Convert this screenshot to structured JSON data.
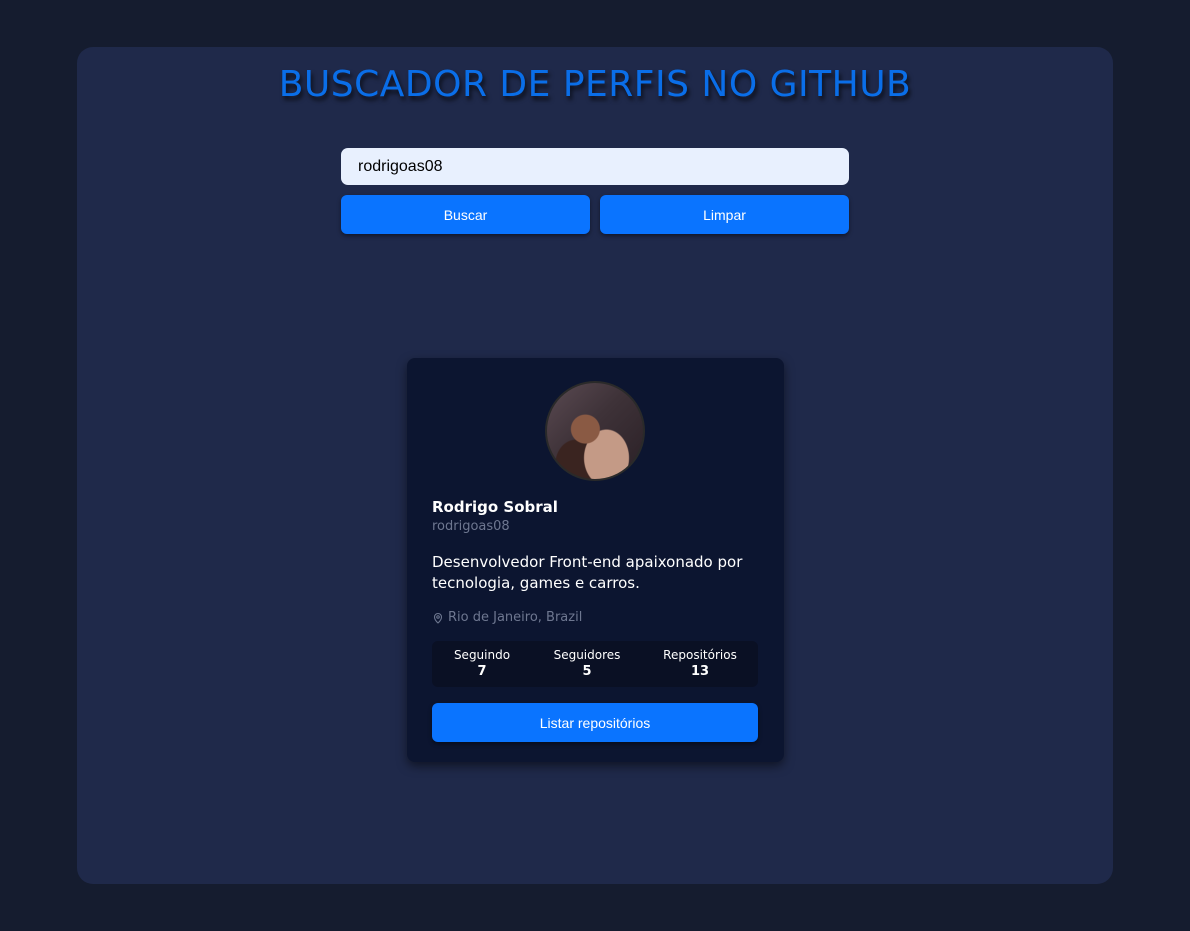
{
  "page": {
    "title": "BUSCADOR DE PERFIS NO GITHUB"
  },
  "search": {
    "value": "rodrigoas08",
    "search_button": "Buscar",
    "clear_button": "Limpar"
  },
  "profile": {
    "name": "Rodrigo Sobral",
    "login": "rodrigoas08",
    "bio": "Desenvolvedor Front-end apaixonado por tecnologia, games e carros.",
    "location": "Rio de Janeiro, Brazil",
    "stats": [
      {
        "label": "Seguindo",
        "value": "7"
      },
      {
        "label": "Seguidores",
        "value": "5"
      },
      {
        "label": "Repositórios",
        "value": "13"
      }
    ],
    "list_repos_button": "Listar repositórios"
  },
  "colors": {
    "page_background": "#151c2f",
    "panel_background": "#1f294a",
    "title": "#0a6ee8",
    "accent": "#0a74ff",
    "card_background": "#0c1530",
    "muted_text": "#6e7790"
  },
  "icons": {
    "location": "map-pin-icon"
  }
}
